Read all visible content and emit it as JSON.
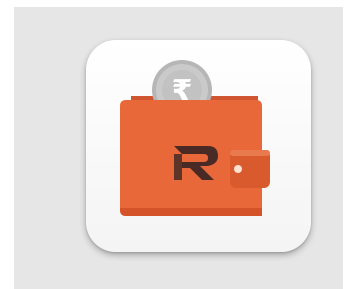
{
  "app_icon": {
    "name": "wallet-app-icon",
    "currency_symbol": "₹",
    "brand_letter": "R",
    "colors": {
      "wallet": "#e8683a",
      "wallet_dark": "#d55328",
      "wallet_back": "#cf5630",
      "coin": "#c9c9c9",
      "coin_rim": "#b6b6b6",
      "coin_symbol": "#ffffff",
      "logo_dark": "#4a2a24",
      "logo_mid": "#5e3328",
      "clasp_dot": "#ffe3d2"
    }
  }
}
